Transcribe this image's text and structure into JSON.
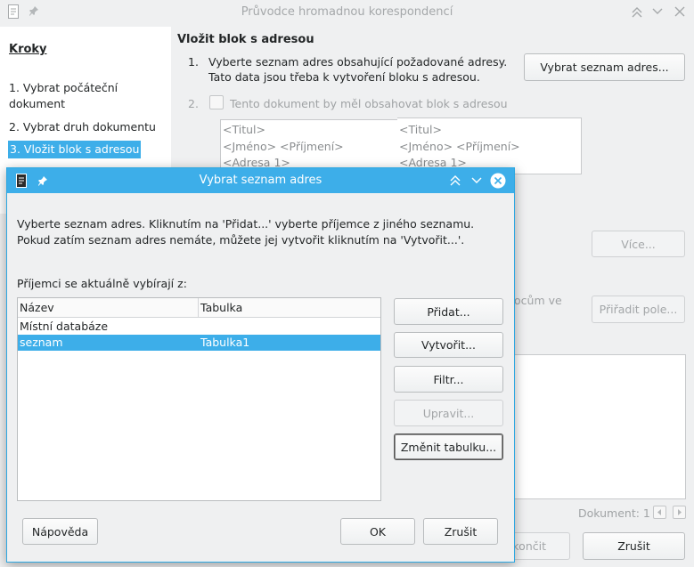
{
  "main_window": {
    "title": "Průvodce hromadnou korespondencí",
    "steps_heading": "Kroky",
    "steps": [
      {
        "label": "1. Vybrat počáteční dokument"
      },
      {
        "label": "2. Vybrat druh dokumentu"
      },
      {
        "label": "3. Vložit blok s adresou"
      }
    ],
    "content_title": "Vložit blok s adresou",
    "step1_num": "1.",
    "step1_line1": "Vyberte seznam adres obsahující požadované adresy.",
    "step1_line2": "Tato data jsou třeba k vytvoření bloku s adresou.",
    "select_list_button": "Vybrat seznam adres...",
    "step2_num": "2.",
    "address_block_checkbox": "Tento dokument by měl obsahovat blok s adresou",
    "preview1": [
      "<Titul>",
      "<Jméno> <Příjmení>",
      "<Adresa 1>"
    ],
    "preview2": [
      "<Titul>",
      "<Jméno> <Příjmení>",
      "<Adresa 1>"
    ],
    "more_button": "Více...",
    "partial_text": "ocům ve",
    "assign_fields_button": "Přiřadit pole...",
    "document_label": "Dokument: 1",
    "finish_button_partial": "okončit",
    "cancel_button": "Zrušit"
  },
  "dialog": {
    "title": "Vybrat seznam adres",
    "instruction": "Vyberte seznam adres. Kliknutím na 'Přidat...' vyberte příjemce z jiného seznamu. Pokud zatím seznam adres nemáte, můžete jej vytvořit kliknutím na 'Vytvořit...'.",
    "recipients_label": "Příjemci se aktuálně vybírají z:",
    "table": {
      "col_name": "Název",
      "col_table": "Tabulka",
      "rows": [
        {
          "name": "Místní databáze",
          "table": ""
        },
        {
          "name": "seznam",
          "table": "Tabulka1"
        }
      ]
    },
    "add_button": "Přidat...",
    "create_button": "Vytvořit...",
    "filter_button": "Filtr...",
    "edit_button": "Upravit...",
    "change_table_button": "Změnit tabulku...",
    "help_button": "Nápověda",
    "ok_button": "OK",
    "cancel_button": "Zrušit"
  },
  "colors": {
    "accent": "#3daee9",
    "selection": "#3daee9",
    "window_bg": "#eff0f1"
  }
}
